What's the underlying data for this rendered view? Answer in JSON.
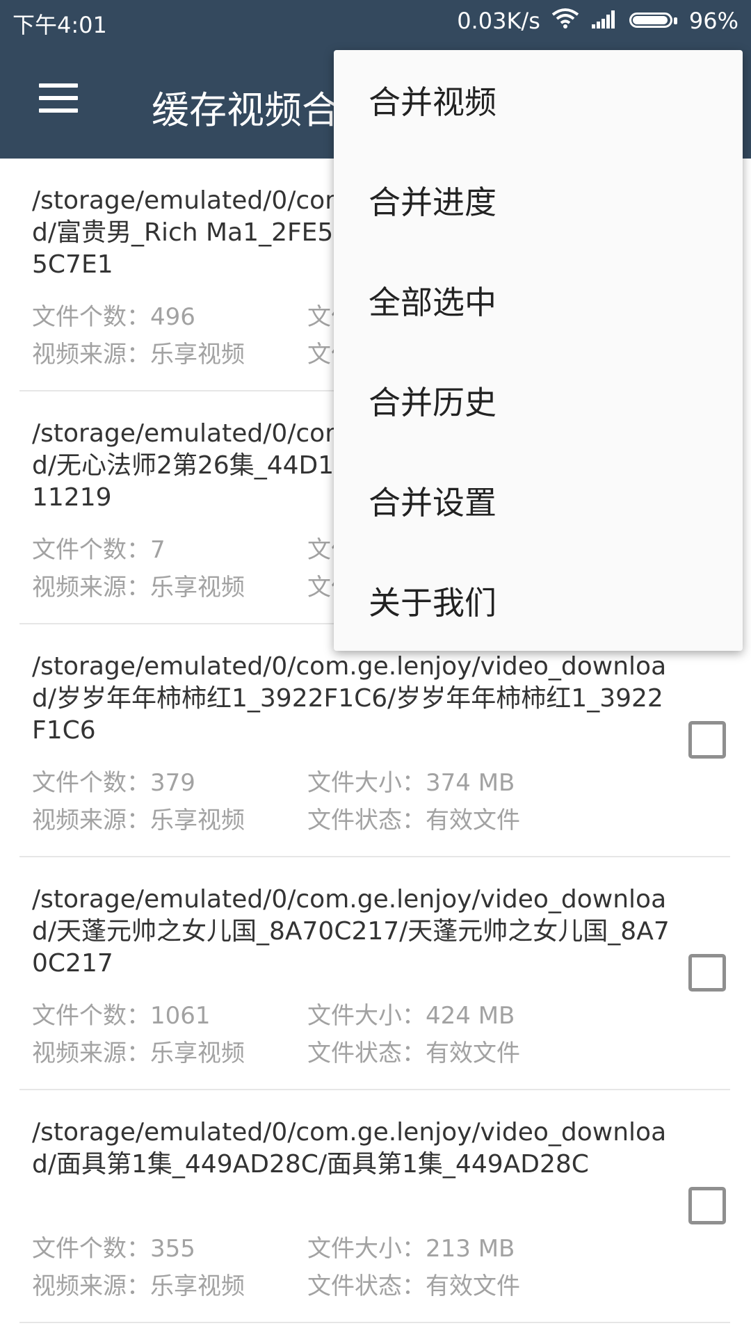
{
  "status_bar": {
    "time": "下午4:01",
    "speed": "0.03K/s",
    "battery": "96%",
    "battery_level": 96,
    "wifi_icon": "wifi-icon",
    "signal_icon": "cell-signal-icon"
  },
  "toolbar": {
    "title": "缓存视频合并",
    "menu_icon": "hamburger-menu-icon"
  },
  "popup_menu": [
    {
      "label": "合并视频"
    },
    {
      "label": "合并进度"
    },
    {
      "label": "全部选中"
    },
    {
      "label": "合并历史"
    },
    {
      "label": "合并设置"
    },
    {
      "label": "关于我们"
    }
  ],
  "items": [
    {
      "path": "/storage/emulated/0/com.ge.lenjoy/video_download/富贵男_Rich Ma1_2FE5C7E1/富贵男_Rich Ma1_2FE5C7E1",
      "count": "文件个数：496",
      "size": "文件大小：",
      "source": "视频来源：乐享视频",
      "status": "文件状态：有效文件",
      "checked": false
    },
    {
      "path": "/storage/emulated/0/com.ge.lenjoy/video_download/无心法师2第26集_44D11219/无心法师2第26集_44D11219",
      "count": "文件个数：7",
      "size": "文件大小：",
      "source": "视频来源：乐享视频",
      "status": "文件状态：有效文件",
      "checked": false
    },
    {
      "path": "/storage/emulated/0/com.ge.lenjoy/video_download/岁岁年年柿柿红1_3922F1C6/岁岁年年柿柿红1_3922F1C6",
      "count": "文件个数：379",
      "size": "文件大小：374 MB",
      "source": "视频来源：乐享视频",
      "status": "文件状态：有效文件",
      "checked": false
    },
    {
      "path": "/storage/emulated/0/com.ge.lenjoy/video_download/天蓬元帅之女儿国_8A70C217/天蓬元帅之女儿国_8A70C217",
      "count": "文件个数：1061",
      "size": "文件大小：424 MB",
      "source": "视频来源：乐享视频",
      "status": "文件状态：有效文件",
      "checked": false
    },
    {
      "path": "/storage/emulated/0/com.ge.lenjoy/video_download/面具第1集_449AD28C/面具第1集_449AD28C",
      "count": "文件个数：355",
      "size": "文件大小：213 MB",
      "source": "视频来源：乐享视频",
      "status": "文件状态：有效文件",
      "checked": false
    }
  ]
}
